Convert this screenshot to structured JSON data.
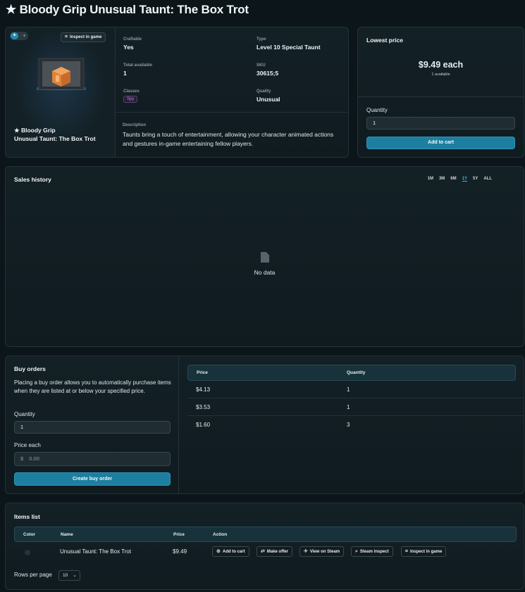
{
  "title": "★ Bloody Grip Unusual Taunt: The Box Trot",
  "item": {
    "inspect_label": "Inspect in game",
    "name": "★ Bloody Grip\nUnusual Taunt: The Box Trot",
    "craftable_label": "Craftable",
    "craftable_value": "Yes",
    "type_label": "Type",
    "type_value": "Level 10 Special Taunt",
    "total_label": "Total available",
    "total_value": "1",
    "sku_label": "SKU",
    "sku_value": "30615;5",
    "classes_label": "Classes",
    "classes_value": "Spy",
    "quality_label": "Quality",
    "quality_value": "Unusual",
    "description_label": "Description",
    "description": "Taunts bring a touch of entertainment, allowing your character animated actions and gestures in-game entertaining fellow players."
  },
  "price_panel": {
    "heading": "Lowest price",
    "price": "$9.49 each",
    "available": "1 available",
    "quantity_label": "Quantity",
    "quantity_value": "1",
    "add_to_cart": "Add to cart"
  },
  "sales_history": {
    "heading": "Sales history",
    "ranges": [
      "1M",
      "3M",
      "6M",
      "1Y",
      "5Y",
      "ALL"
    ],
    "active_range": "1Y",
    "empty_text": "No data"
  },
  "buy_orders": {
    "heading": "Buy orders",
    "description": "Placing a buy order allows you to automatically purchase items when they are listed at or below your specified price.",
    "quantity_label": "Quantity",
    "quantity_value": "1",
    "price_label": "Price each",
    "price_prefix": "$",
    "price_placeholder": "0.00",
    "create_button": "Create buy order",
    "columns": [
      "Price",
      "Quantity"
    ],
    "rows": [
      {
        "price": "$4.13",
        "quantity": "1"
      },
      {
        "price": "$3.53",
        "quantity": "1"
      },
      {
        "price": "$1.60",
        "quantity": "3"
      }
    ]
  },
  "items_list": {
    "heading": "Items list",
    "columns": [
      "Color",
      "Name",
      "Price",
      "Action"
    ],
    "rows": [
      {
        "name": "Unusual Taunt: The Box Trot",
        "price": "$9.49"
      }
    ],
    "actions": [
      "Add to cart",
      "Make offer",
      "View on Steam",
      "Steam inspect",
      "Inspect in game"
    ],
    "rows_per_page_label": "Rows per page",
    "rows_per_page_value": "10"
  },
  "colors": {
    "accent": "#1d7fa0",
    "background": "#0c1519",
    "panel_border": "#22333a",
    "class_badge": "#b98be0"
  }
}
